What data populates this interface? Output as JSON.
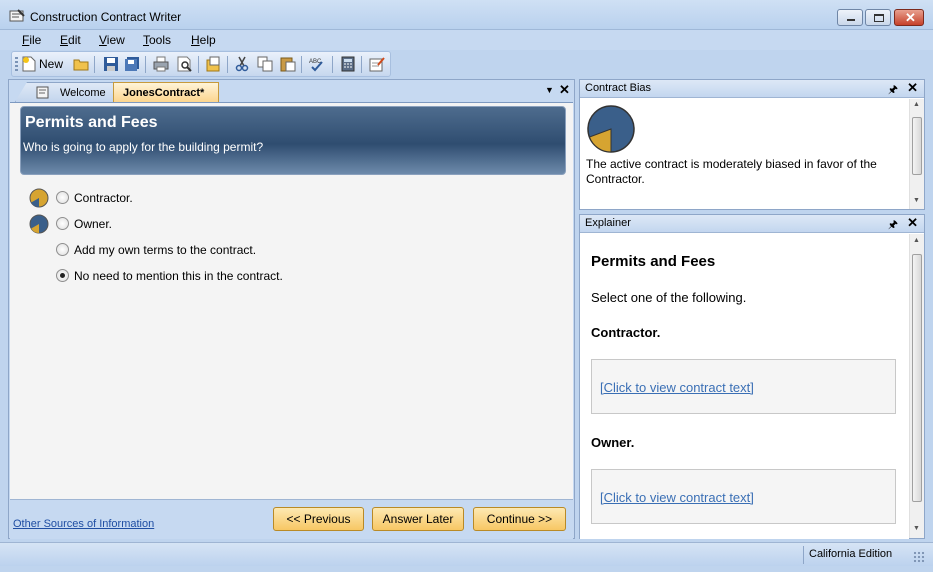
{
  "window": {
    "title": "Construction Contract Writer"
  },
  "menu": [
    "File",
    "Edit",
    "View",
    "Tools",
    "Help"
  ],
  "toolbar": {
    "new_label": "New",
    "icons": [
      "new-icon",
      "open-icon",
      "save-icon",
      "save-all-icon",
      "print-icon",
      "print-preview-icon",
      "export-icon",
      "cut-icon",
      "copy-icon",
      "paste-icon",
      "spellcheck-icon",
      "calculator-icon",
      "form-icon"
    ]
  },
  "tabs": [
    {
      "label": "Welcome",
      "active": false
    },
    {
      "label": "JonesContract*",
      "active": true
    }
  ],
  "question": {
    "title": "Permits and Fees",
    "prompt": "Who is going to apply for the building permit?",
    "options": [
      {
        "label": "Contractor.",
        "checked": false,
        "bias": "contractor"
      },
      {
        "label": "Owner.",
        "checked": false,
        "bias": "owner"
      },
      {
        "label": "Add my own terms to the contract.",
        "checked": false,
        "bias": ""
      },
      {
        "label": "No need to mention this in the contract.",
        "checked": true,
        "bias": ""
      }
    ]
  },
  "footer": {
    "other_sources": "Other Sources of Information",
    "previous": "<< Previous",
    "answer_later": "Answer Later",
    "continue": "Continue >>"
  },
  "bias_panel": {
    "title": "Contract Bias",
    "text": "The active contract is moderately biased in favor of the Contractor."
  },
  "explainer_panel": {
    "title": "Explainer",
    "heading": "Permits and Fees",
    "intro": "Select one of the following.",
    "sections": [
      {
        "heading": "Contractor.",
        "link": "[Click to view contract text]"
      },
      {
        "heading": "Owner.",
        "link": "[Click to view contract text]"
      }
    ]
  },
  "status": {
    "edition": "California Edition"
  },
  "colors": {
    "pie_blue": "#3a5f8a",
    "pie_gold": "#d6a431",
    "link": "#3a6fb5"
  }
}
